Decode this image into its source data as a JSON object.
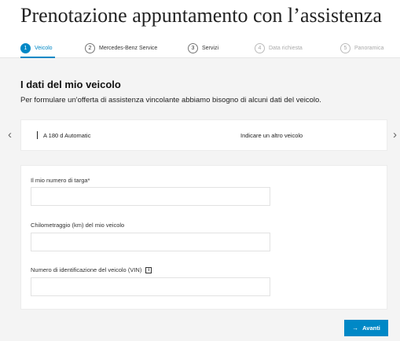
{
  "page": {
    "title": "Prenotazione appuntamento con l’assistenza"
  },
  "stepper": {
    "steps": [
      {
        "number": "1",
        "label": "Veicolo",
        "state": "active"
      },
      {
        "number": "2",
        "label": "Mercedes-Benz Service",
        "state": "default"
      },
      {
        "number": "3",
        "label": "Servizi",
        "state": "default"
      },
      {
        "number": "4",
        "label": "Data richiesta",
        "state": "disabled"
      },
      {
        "number": "5",
        "label": "Panoramica",
        "state": "disabled"
      }
    ]
  },
  "vehicle_section": {
    "heading": "I dati del mio veicolo",
    "description": "Per formulare un'offerta di assistenza vincolante abbiamo bisogno di alcuni dati del veicolo.",
    "selected_vehicle": "A 180 d Automatic",
    "other_vehicle_link": "Indicare un altro veicolo",
    "prev_icon": "chevron-left-icon",
    "next_icon": "chevron-right-icon"
  },
  "form": {
    "plate_label": "Il mio numero di targa*",
    "plate_value": "",
    "mileage_label": "Chilometraggio (km) del mio veicolo",
    "mileage_value": "",
    "vin_label": "Numero di identificazione del veicolo (VIN)",
    "vin_info_icon": "i",
    "vin_value": ""
  },
  "actions": {
    "next_label": "Avanti",
    "next_icon": "arrow-right-icon"
  },
  "colors": {
    "accent": "#0088c6",
    "content_background": "#f4f4f4"
  }
}
